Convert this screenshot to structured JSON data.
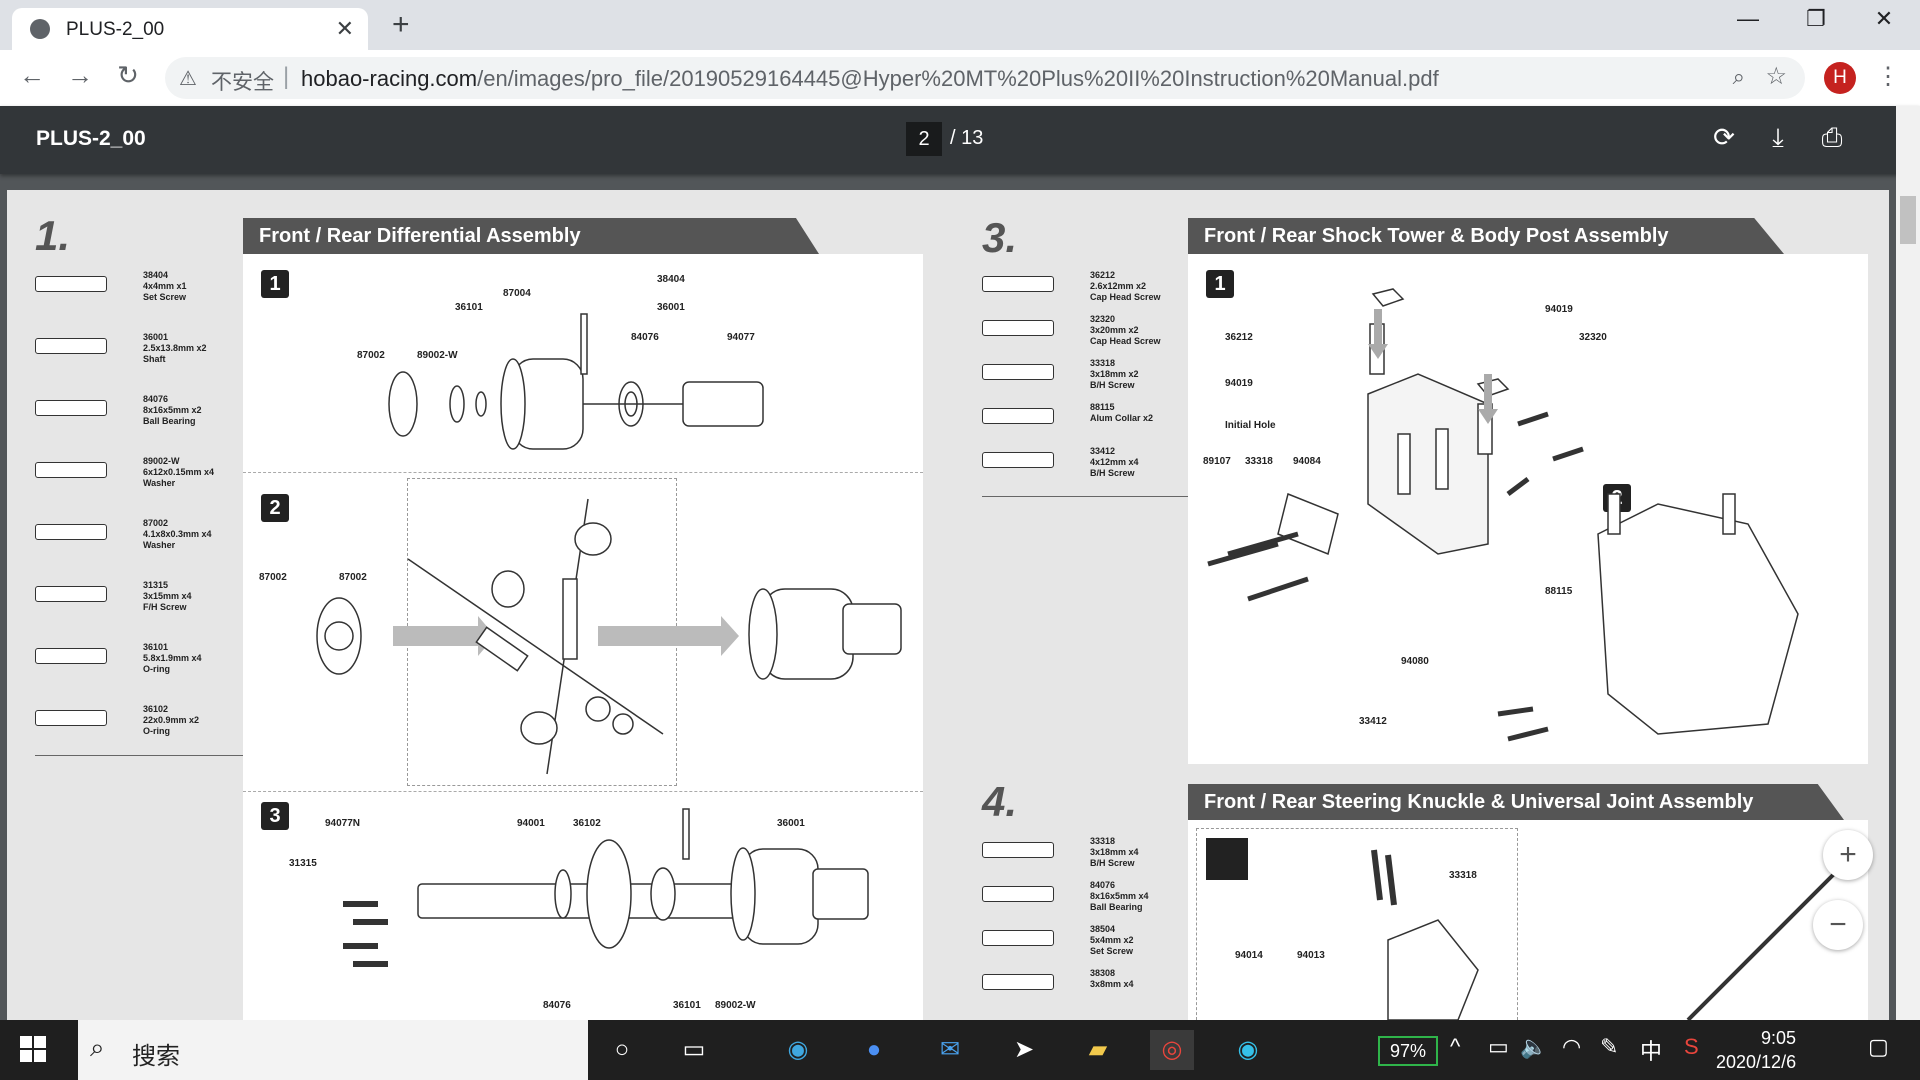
{
  "browser": {
    "tab_title": "PLUS-2_00",
    "close_glyph": "✕",
    "new_tab_glyph": "+",
    "win_min": "—",
    "win_max": "❐",
    "win_close": "✕",
    "back": "←",
    "forward": "→",
    "reload": "↻",
    "security_label": "不安全",
    "url_host": "hobao-racing.com",
    "url_path": "/en/images/pro_file/20190529164445@Hyper%20MT%20Plus%20II%20Instruction%20Manual.pdf",
    "avatar_letter": "H"
  },
  "pdf_toolbar": {
    "doc_title": "PLUS-2_00",
    "page_current": "2",
    "page_total": "/ 13"
  },
  "manual": {
    "sections": [
      {
        "num": "1.",
        "banner": "Front / Rear Differential Assembly"
      },
      {
        "num": "3.",
        "banner": "Front  / Rear Shock Tower & Body Post Assembly"
      },
      {
        "num": "4.",
        "banner": "Front / Rear Steering Knuckle & Universal Joint Assembly"
      }
    ],
    "parts_left": [
      {
        "code": "38404",
        "size": "4x4mm x1",
        "name": "Set Screw"
      },
      {
        "code": "36001",
        "size": "2.5x13.8mm x2",
        "name": "Shaft"
      },
      {
        "code": "84076",
        "size": "8x16x5mm x2",
        "name": "Ball Bearing"
      },
      {
        "code": "89002-W",
        "size": "6x12x0.15mm x4",
        "name": "Washer"
      },
      {
        "code": "87002",
        "size": "4.1x8x0.3mm x4",
        "name": "Washer"
      },
      {
        "code": "31315",
        "size": "3x15mm x4",
        "name": "F/H Screw"
      },
      {
        "code": "36101",
        "size": "5.8x1.9mm x4",
        "name": "O-ring"
      },
      {
        "code": "36102",
        "size": "22x0.9mm x2",
        "name": "O-ring"
      }
    ],
    "parts_mid": [
      {
        "code": "36212",
        "size": "2.6x12mm x2",
        "name": "Cap Head Screw"
      },
      {
        "code": "32320",
        "size": "3x20mm x2",
        "name": "Cap Head Screw"
      },
      {
        "code": "33318",
        "size": "3x18mm x2",
        "name": "B/H Screw"
      },
      {
        "code": "88115",
        "size": "Alum Collar x2",
        "name": ""
      },
      {
        "code": "33412",
        "size": "4x12mm x4",
        "name": "B/H Screw"
      }
    ],
    "parts_mid2": [
      {
        "code": "33318",
        "size": "3x18mm x4",
        "name": "B/H Screw"
      },
      {
        "code": "84076",
        "size": "8x16x5mm x4",
        "name": "Ball Bearing"
      },
      {
        "code": "38504",
        "size": "5x4mm x2",
        "name": "Set Screw"
      },
      {
        "code": "38308",
        "size": "3x8mm x4",
        "name": ""
      }
    ],
    "steps": [
      "1",
      "2",
      "3",
      "1",
      "2"
    ],
    "diff_labels": [
      "38404",
      "87004",
      "36101",
      "36001",
      "84076",
      "94077",
      "87002",
      "89002-W",
      "87002",
      "87002",
      "94077N",
      "94001",
      "36102",
      "36001",
      "31315",
      "84076",
      "36101",
      "89002-W"
    ],
    "tower_labels": [
      "94019",
      "32320",
      "36212",
      "94019",
      "Initial Hole",
      "89107",
      "33318",
      "94084",
      "88115",
      "94080",
      "33412"
    ],
    "knuckle_labels": [
      "33318",
      "94014",
      "94013"
    ]
  },
  "taskbar": {
    "search_text": "搜索",
    "battery": "97%",
    "ime": "中",
    "time": "9:05",
    "date": "2020/12/6"
  }
}
